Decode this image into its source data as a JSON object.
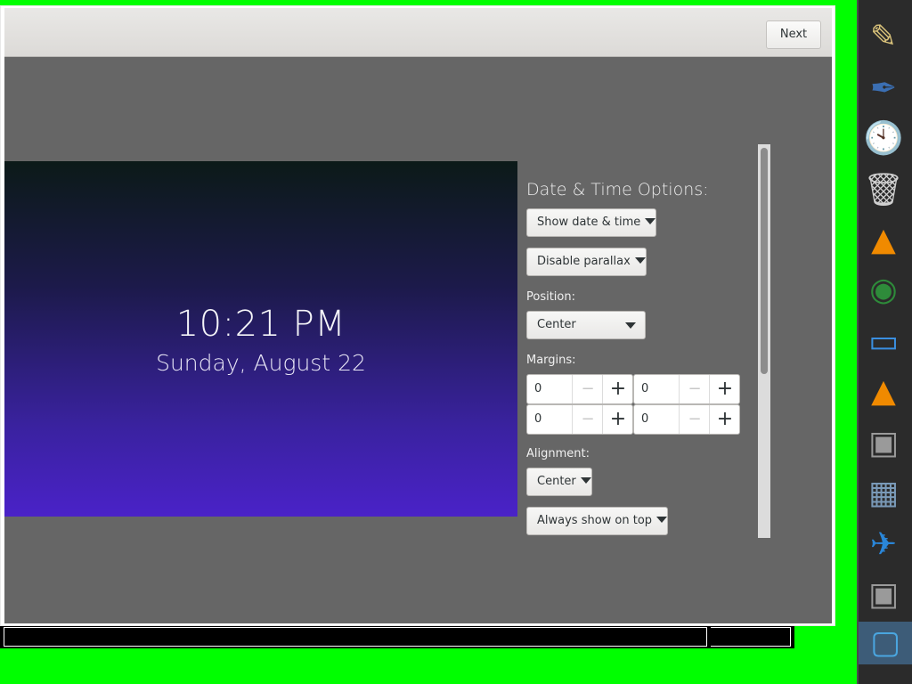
{
  "window": {
    "next_label": "Next"
  },
  "preview": {
    "time": "10:21 PM",
    "date": "Sunday, August 22"
  },
  "options": {
    "title": "Date & Time Options:",
    "show_date_time": "Show date & time",
    "parallax": "Disable parallax",
    "position_label": "Position:",
    "position_value": "Center",
    "margins_label": "Margins:",
    "margins": [
      "0",
      "0",
      "0",
      "0"
    ],
    "minus_glyph": "−",
    "plus_glyph": "+",
    "alignment_label": "Alignment:",
    "alignment_value": "Center",
    "on_top": "Always show on top"
  },
  "dock": {
    "items": [
      {
        "icon": "pencil-cup-icon",
        "glyph": "✎",
        "color": "#d9c27a"
      },
      {
        "icon": "text-editor-feather-icon",
        "glyph": "✒",
        "color": "#3b6fb3"
      },
      {
        "icon": "clock-icon",
        "glyph": "🕙",
        "color": "#e0e0e0"
      },
      {
        "icon": "trash-icon",
        "glyph": "🗑",
        "color": "#d0d0d0"
      },
      {
        "icon": "vlc-cone-icon",
        "glyph": "▲",
        "color": "#f08a00"
      },
      {
        "icon": "radar-icon",
        "glyph": "◉",
        "color": "#2e8b3a"
      },
      {
        "icon": "window-manager-icon",
        "glyph": "▭",
        "color": "#3a8fe0"
      },
      {
        "icon": "vlc-cone-icon",
        "glyph": "▲",
        "color": "#f08a00"
      },
      {
        "icon": "terminal-icon",
        "glyph": "▣",
        "color": "#9a9a9a"
      },
      {
        "icon": "image-viewer-icon",
        "glyph": "▦",
        "color": "#7a9ab8"
      },
      {
        "icon": "bird-icon",
        "glyph": "✈",
        "color": "#2a86d8"
      },
      {
        "icon": "terminal-icon",
        "glyph": "▣",
        "color": "#9a9a9a"
      },
      {
        "icon": "screen-settings-icon",
        "glyph": "▢",
        "color": "#4aa6e0"
      }
    ]
  }
}
